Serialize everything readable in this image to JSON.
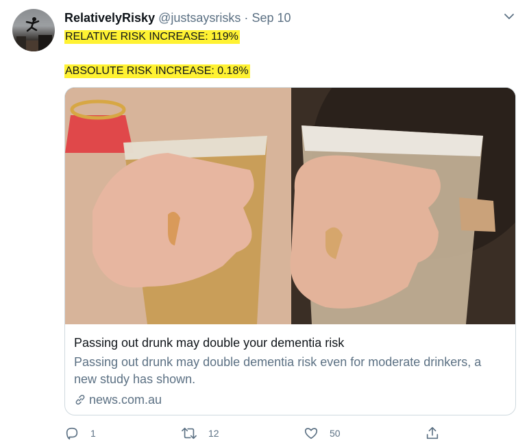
{
  "tweet": {
    "display_name": "RelativelyRisky",
    "handle": "@justsaysrisks",
    "separator": "·",
    "date": "Sep 10",
    "line1": "RELATIVE RISK INCREASE: 119%",
    "line2": "ABSOLUTE RISK INCREASE: 0.18%",
    "highlight_color": "#fff232"
  },
  "card": {
    "title": "Passing out drunk may double your dementia risk",
    "description": "Passing out drunk may double dementia risk even for moderate drinkers, a new study has shown.",
    "domain": "news.com.au",
    "image": "two-hands-holding-plastic-beer-cups"
  },
  "actions": {
    "reply_count": "1",
    "retweet_count": "12",
    "like_count": "50"
  },
  "icons": {
    "caret": "chevron-down-icon",
    "reply": "reply-icon",
    "retweet": "retweet-icon",
    "like": "heart-icon",
    "share": "share-icon",
    "link": "link-icon"
  },
  "colors": {
    "secondary_text": "#5b7083",
    "border": "#cfd9de"
  }
}
